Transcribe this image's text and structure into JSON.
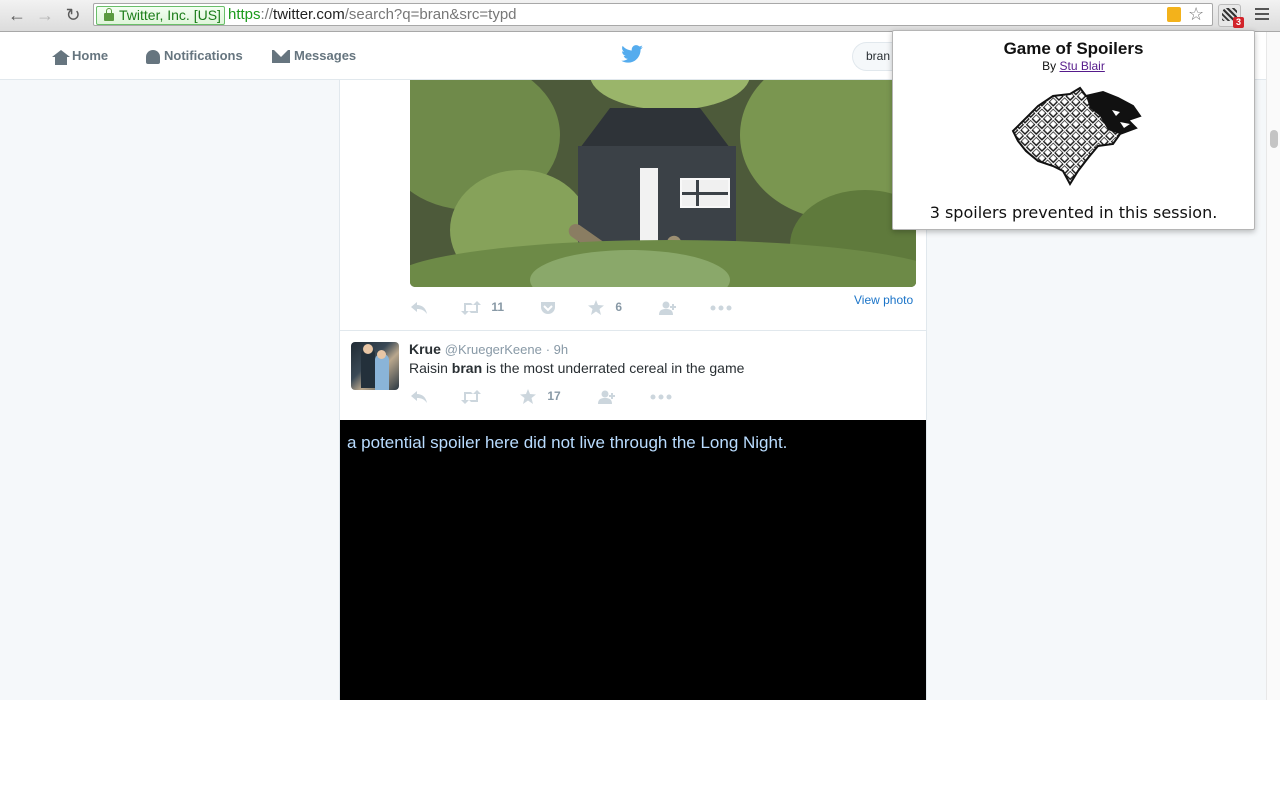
{
  "browser": {
    "ev_label": "Twitter, Inc. [US]",
    "url_scheme": "https",
    "url_sep": "://",
    "url_host": "twitter.com",
    "url_path": "/search?q=bran&src=typd",
    "extension_badge": "3"
  },
  "nav": {
    "home": "Home",
    "notifications": "Notifications",
    "messages": "Messages",
    "search_value": "bran"
  },
  "tweet1": {
    "retweets": "11",
    "likes": "6",
    "view_photo": "View photo"
  },
  "tweet2": {
    "name": "Krue",
    "handle": "@KruegerKeene",
    "time": "· 9h",
    "text_before": "Raisin ",
    "text_bold": "bran",
    "text_after": " is the most underrated cereal in the game",
    "likes": "17"
  },
  "spoiler": {
    "text": "a potential spoiler here did not live through the Long Night."
  },
  "popup": {
    "title": "Game of Spoilers",
    "by_prefix": "By ",
    "author": "Stu Blair",
    "status": "3 spoilers prevented in this session."
  },
  "colors": {
    "twitter_blue": "#55acee",
    "spoiler_text": "#b9dcff",
    "ev_green": "#1b7d19"
  }
}
